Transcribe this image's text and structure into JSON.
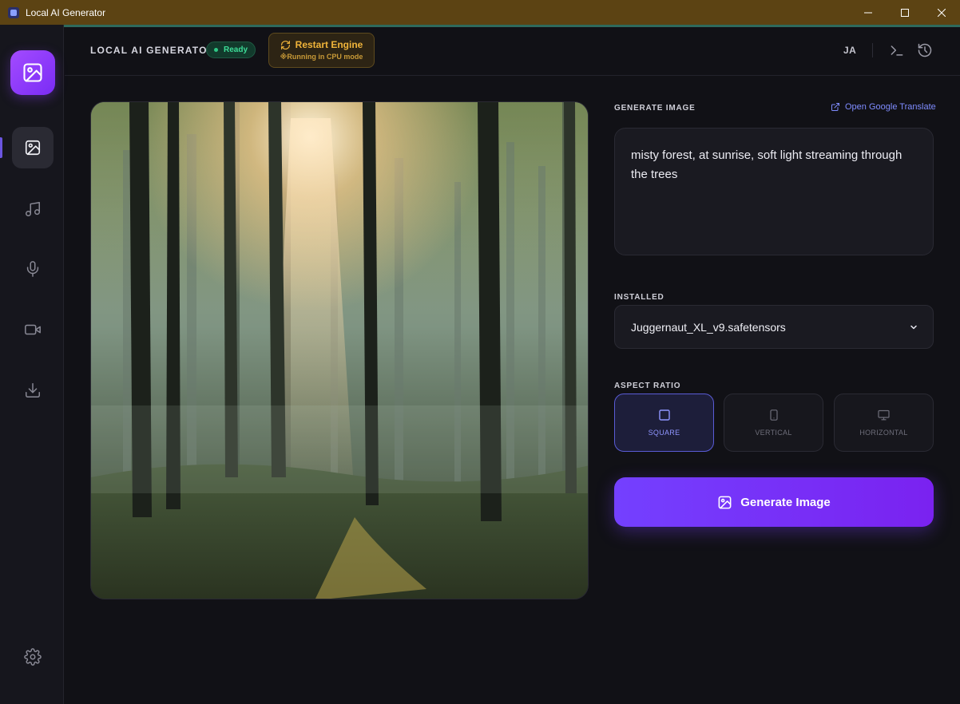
{
  "window": {
    "title": "Local AI Generator",
    "controls": [
      "minimize-icon",
      "maximize-icon",
      "close-icon"
    ]
  },
  "sidebar": {
    "logo_icon": "image-icon",
    "items": [
      {
        "icon": "image-icon",
        "active": true
      },
      {
        "icon": "music-icon",
        "active": false
      },
      {
        "icon": "microphone-icon",
        "active": false
      },
      {
        "icon": "video-icon",
        "active": false
      },
      {
        "icon": "download-icon",
        "active": false
      }
    ],
    "settings_icon": "gear-icon"
  },
  "header": {
    "brand": "LOCAL AI GENERATOR",
    "status": "Ready",
    "restart_label": "Restart Engine",
    "restart_sub": "※Running in CPU mode",
    "language": "JA",
    "icons": [
      "terminal-icon",
      "history-icon"
    ]
  },
  "generate": {
    "section_label": "GENERATE IMAGE",
    "translate_link": "Open Google Translate",
    "prompt": "misty forest, at sunrise, soft light streaming through the trees"
  },
  "model": {
    "label": "INSTALLED",
    "selected": "Juggernaut_XL_v9.safetensors"
  },
  "aspect": {
    "label": "ASPECT RATIO",
    "options": [
      {
        "label": "SQUARE",
        "active": true
      },
      {
        "label": "VERTICAL",
        "active": false
      },
      {
        "label": "HORIZONTAL",
        "active": false
      }
    ]
  },
  "action": {
    "generate_label": "Generate Image"
  },
  "colors": {
    "accent": "#7440ff",
    "status_green": "#3ddc97",
    "warning": "#f0b43a",
    "link": "#7f8cff"
  }
}
